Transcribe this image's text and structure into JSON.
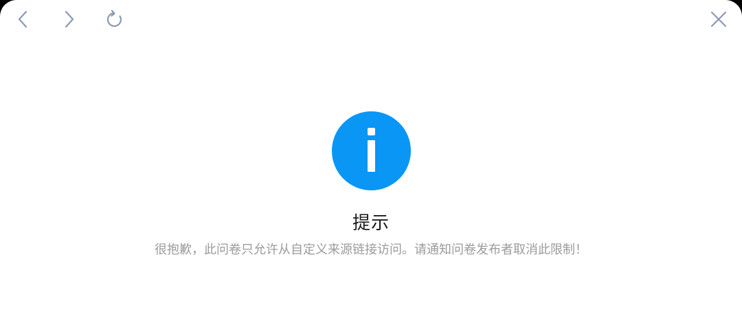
{
  "toolbar": {
    "back_icon": "chevron-left-icon",
    "forward_icon": "chevron-right-icon",
    "reload_icon": "reload-icon",
    "close_icon": "close-icon",
    "icon_color": "#8a99b3"
  },
  "dialog": {
    "icon": "info-icon",
    "icon_color": "#0a96f5",
    "title": "提示",
    "message": "很抱歉，此问卷只允许从自定义来源链接访问。请通知问卷发布者取消此限制！"
  }
}
